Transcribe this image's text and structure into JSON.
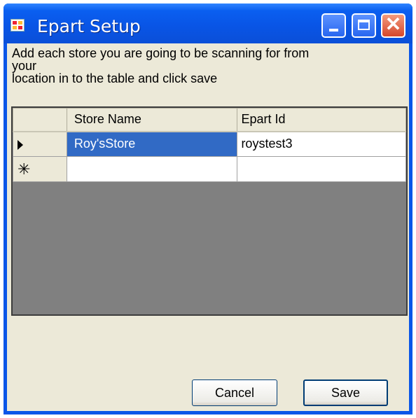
{
  "window": {
    "title": "Epart Setup",
    "title_icon": "app-window-icon",
    "controls": {
      "minimize_icon": "minimize-icon",
      "maximize_icon": "maximize-icon",
      "close_icon": "close-icon",
      "close_glyph": "✕"
    }
  },
  "instructions": {
    "line1": "Add each store you are going to be scanning for from",
    "line2": "your",
    "line3": "location in to the table and click save"
  },
  "grid": {
    "columns": [
      "Store Name",
      "Epart Id"
    ],
    "rows": [
      {
        "indicator": "current-row-arrow",
        "store_name": "Roy'sStore",
        "epart_id": "roystest3",
        "selected_cell": "store_name"
      },
      {
        "indicator": "new-row",
        "indicator_glyph": "✳",
        "store_name": "",
        "epart_id": ""
      }
    ],
    "empty_area_color": "#808080",
    "selection_color": "#316ac5"
  },
  "buttons": {
    "cancel": "Cancel",
    "save": "Save"
  },
  "colors": {
    "titlebar": "#0955e6",
    "client_background": "#ece9d8",
    "close_button": "#d6472a"
  }
}
